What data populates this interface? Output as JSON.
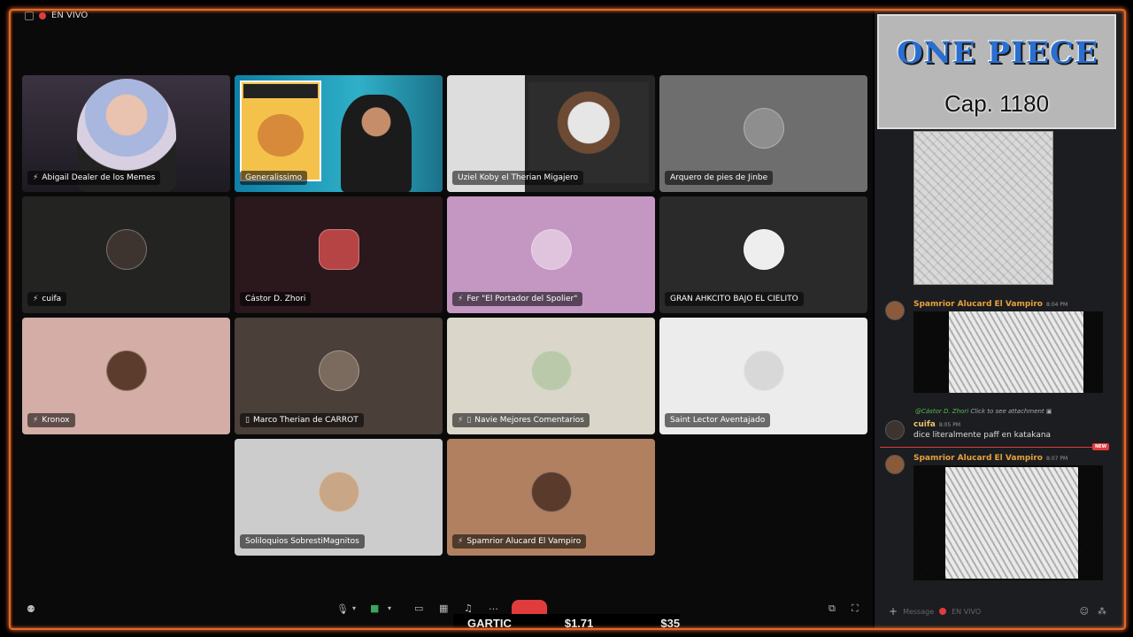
{
  "top": {
    "live_label": "EN VIVO"
  },
  "participants": [
    {
      "name": "Abigail Dealer de los Memes",
      "muted": true,
      "bg": "#2a2230",
      "video": true
    },
    {
      "name": "Generalissimo",
      "muted": false,
      "bg": "#1d6f8e",
      "video": true
    },
    {
      "name": "Uziel Koby el Therian Migajero",
      "muted": false,
      "bg": "#3a3a3a",
      "video": true
    },
    {
      "name": "Arquero de pies de Jinbe",
      "muted": false,
      "bg": "#6e6e6e"
    },
    {
      "name": "cuifa",
      "muted": true,
      "bg": "#232422"
    },
    {
      "name": "Cástor D. Zhori",
      "muted": false,
      "bg": "#2a181d"
    },
    {
      "name": "Fer \"El Portador del Spolier\"",
      "muted": true,
      "bg": "#c497c3"
    },
    {
      "name": "GRAN AHKCITO BAJO EL CIELITO",
      "muted": false,
      "bg": "#2a2a2a"
    },
    {
      "name": "Kronox",
      "muted": true,
      "bg": "#d4ada6"
    },
    {
      "name": "Marco Therian de CARROT",
      "muted": false,
      "mobile": true,
      "bg": "#4a3f39"
    },
    {
      "name": "Navie Mejores Comentarios",
      "muted": true,
      "mobile": true,
      "bg": "#dad6c9"
    },
    {
      "name": "Saint Lector Aventajado",
      "muted": false,
      "bg": "#ececec"
    },
    {
      "name": "Soliloquios SobrestiMagnitos",
      "muted": false,
      "bg": "#cccccc"
    },
    {
      "name": "Spamrior Alucard El Vampiro",
      "muted": true,
      "bg": "#b08060"
    }
  ],
  "overlay": {
    "title": "ONE PIECE",
    "chapter": "Cap. 1180"
  },
  "chat": {
    "messages": [
      {
        "user": "Spamrior Alucard El Vampiro",
        "time": "8:04 PM"
      },
      {
        "reply_mention": "@Cástor D. Zhori",
        "reply_text": "Click to see attachment",
        "user": "cuifa",
        "time": "8:05 PM",
        "text": "dice literalmente paff en katakana"
      },
      {
        "user": "Spamrior Alucard El Vampiro",
        "time": "8:07 PM"
      }
    ],
    "new_badge": "NEW",
    "input_placeholder": "Message",
    "input_channel": "EN VIVO"
  },
  "ticker": {
    "brand": "GARTIC",
    "value1": "$1.71",
    "value2": "$35"
  },
  "colors": {
    "accent": "#e8662a",
    "live": "#e23b3b",
    "speaking": "#3ba55c"
  }
}
